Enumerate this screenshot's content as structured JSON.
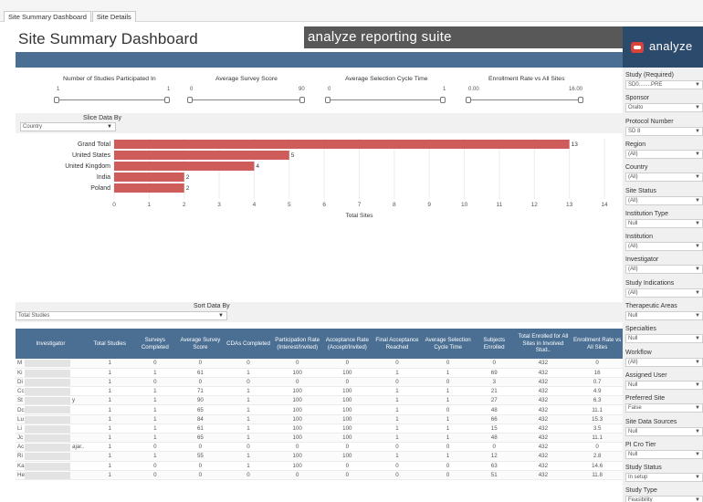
{
  "tabs": [
    {
      "label": "Site Summary Dashboard",
      "active": true
    },
    {
      "label": "Site Details",
      "active": false
    }
  ],
  "header": {
    "title": "Site Summary Dashboard",
    "banner": "analyze reporting suite"
  },
  "brand": {
    "logo_text": "analyze",
    "logo_icon": "brand-logo-icon"
  },
  "sliders": [
    {
      "title": "Number of Studies Participated In",
      "min": "1",
      "max": "1"
    },
    {
      "title": "Average Survey Score",
      "min": "0",
      "max": "90"
    },
    {
      "title": "Average Selection Cycle Time",
      "min": "0",
      "max": "1"
    },
    {
      "title": "Enrollment Rate vs All Sites",
      "min": "0.00",
      "max": "16.00"
    }
  ],
  "slice": {
    "label": "Slice Data By",
    "value": "Country"
  },
  "sort": {
    "label": "Sort Data By",
    "value": "Total Studies"
  },
  "chart_data": {
    "type": "bar",
    "orientation": "horizontal",
    "categories": [
      "Grand Total",
      "United States",
      "United Kingdom",
      "India",
      "Poland"
    ],
    "values": [
      13,
      5,
      4,
      2,
      2
    ],
    "xlabel": "Total Sites",
    "xlim": [
      0,
      14
    ],
    "xticks": [
      "0",
      "1",
      "2",
      "3",
      "4",
      "5",
      "6",
      "7",
      "8",
      "9",
      "10",
      "11",
      "12",
      "13",
      "14"
    ],
    "bar_color": "#cd5c5a",
    "grid": true
  },
  "table": {
    "headers": [
      "Investigator",
      "Total Studies",
      "Surveys Completed",
      "Average Survey Score",
      "CDAs Completed",
      "Participation Rate (Interest/Invited)",
      "Acceptance Rate (Accept/Invited)",
      "Final Acceptance Reached",
      "Average Selection Cycle Time",
      "Subjects Enrolled",
      "Total Enrolled for All Sites in Involved Stud..",
      "Enrollment Rate vs All Sites"
    ],
    "rows": [
      [
        "M",
        "",
        "1",
        "0",
        "0",
        "0",
        "0",
        "0",
        "0",
        "0",
        "0",
        "432",
        "0"
      ],
      [
        "Ki",
        "",
        "1",
        "1",
        "61",
        "1",
        "100",
        "100",
        "1",
        "1",
        "69",
        "432",
        "16"
      ],
      [
        "Di",
        "",
        "1",
        "0",
        "0",
        "0",
        "0",
        "0",
        "0",
        "0",
        "3",
        "432",
        "0.7"
      ],
      [
        "Cc",
        "",
        "1",
        "1",
        "71",
        "1",
        "100",
        "100",
        "1",
        "1",
        "21",
        "432",
        "4.9"
      ],
      [
        "St",
        "y",
        "1",
        "1",
        "90",
        "1",
        "100",
        "100",
        "1",
        "1",
        "27",
        "432",
        "6.3"
      ],
      [
        "Dc",
        "",
        "1",
        "1",
        "65",
        "1",
        "100",
        "100",
        "1",
        "0",
        "48",
        "432",
        "11.1"
      ],
      [
        "Lu",
        "",
        "1",
        "1",
        "84",
        "1",
        "100",
        "100",
        "1",
        "1",
        "66",
        "432",
        "15.3"
      ],
      [
        "Li",
        "",
        "1",
        "1",
        "61",
        "1",
        "100",
        "100",
        "1",
        "1",
        "15",
        "432",
        "3.5"
      ],
      [
        "Jc",
        "",
        "1",
        "1",
        "65",
        "1",
        "100",
        "100",
        "1",
        "1",
        "48",
        "432",
        "11.1"
      ],
      [
        "Ac",
        "ajar..",
        "1",
        "0",
        "0",
        "0",
        "0",
        "0",
        "0",
        "0",
        "0",
        "432",
        "0"
      ],
      [
        "Ri",
        "",
        "1",
        "1",
        "55",
        "1",
        "100",
        "100",
        "1",
        "1",
        "12",
        "432",
        "2.8"
      ],
      [
        "Ka",
        "",
        "1",
        "0",
        "0",
        "1",
        "100",
        "0",
        "0",
        "0",
        "63",
        "432",
        "14.6"
      ],
      [
        "He",
        "",
        "1",
        "0",
        "0",
        "0",
        "0",
        "0",
        "0",
        "0",
        "51",
        "432",
        "11.8"
      ]
    ]
  },
  "filters": [
    {
      "label": "Study (Required)",
      "value": "SD0........PRE"
    },
    {
      "label": "Sponsor",
      "value": "Oralto"
    },
    {
      "label": "Protocol Number",
      "value": "SD              8"
    },
    {
      "label": "Region",
      "value": "(All)"
    },
    {
      "label": "Country",
      "value": "(All)"
    },
    {
      "label": "Site Status",
      "value": "(All)"
    },
    {
      "label": "Institution Type",
      "value": "Null"
    },
    {
      "label": "Institution",
      "value": "(All)"
    },
    {
      "label": "Investigator",
      "value": "(All)"
    },
    {
      "label": "Study Indications",
      "value": "(All)"
    },
    {
      "label": "Therapeutic Areas",
      "value": "Null"
    },
    {
      "label": "Specialties",
      "value": "Null"
    },
    {
      "label": "Workflow",
      "value": "(All)"
    },
    {
      "label": "Assigned User",
      "value": "Null"
    },
    {
      "label": "Preferred Site",
      "value": "False"
    },
    {
      "label": "Site Data Sources",
      "value": "Null"
    },
    {
      "label": "PI Cro Tier",
      "value": "Null"
    },
    {
      "label": "Study Status",
      "value": "In setup"
    },
    {
      "label": "Study Type",
      "value": "Feasibility"
    }
  ],
  "colors": {
    "header_blue": "#4a6f93",
    "bar_red": "#cd5c5a",
    "logo_bg": "#2c4a6b",
    "banner_gray": "#585858"
  }
}
